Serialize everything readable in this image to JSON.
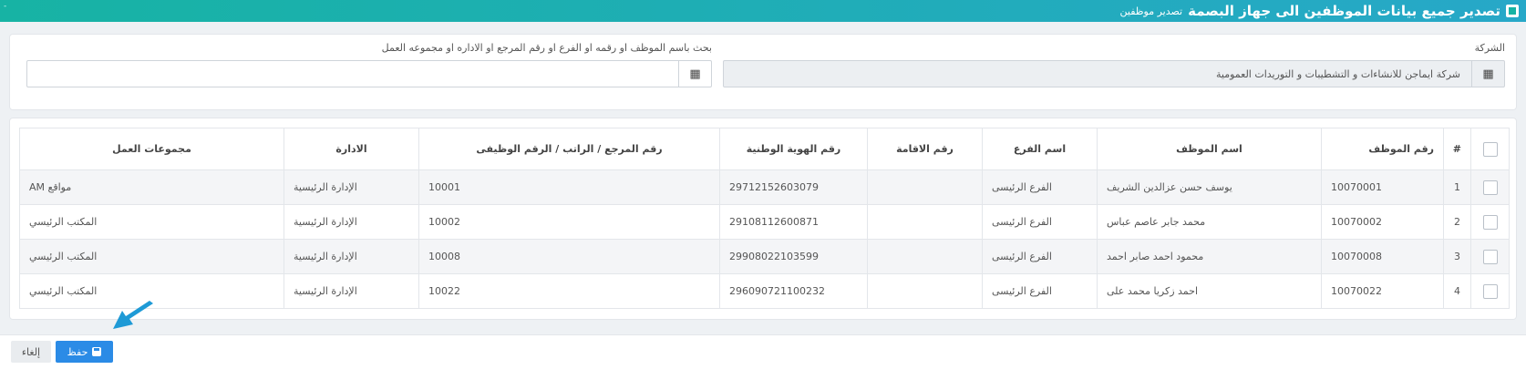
{
  "header": {
    "title": "تصدير جميع بيانات الموظفين الى جهاز البصمة",
    "subtitle": "تصدير موظفين",
    "corner_mark": "-"
  },
  "filters": {
    "company_label": "الشركة",
    "company_value": "شركة ايماجن للانشاءات و التشطيبات و التوريدات العمومية",
    "search_label": "بحث باسم الموظف او رقمه او الفرع او رقم المرجع او الاداره او مجموعه العمل",
    "search_value": "",
    "prefix_icon": "building-icon"
  },
  "table": {
    "headers": {
      "number": "#",
      "emp_id": "رقم الموظف",
      "emp_name": "اسم الموظف",
      "branch": "اسم الفرع",
      "residence": "رقم الاقامة",
      "national_id": "رقم الهوية الوطنية",
      "reference": "رقم المرجع / الراتب / الرقم الوظيفى",
      "department": "الادارة",
      "workgroup": "مجموعات العمل"
    },
    "rows": [
      {
        "num": "1",
        "emp_id": "10070001",
        "emp_name": "يوسف حسن عزالدين الشريف",
        "branch": "الفرع الرئيسى",
        "residence": "",
        "national_id": "29712152603079",
        "reference": "10001",
        "department": "الإدارة الرئيسية",
        "workgroup": "مواقع AM"
      },
      {
        "num": "2",
        "emp_id": "10070002",
        "emp_name": "محمد جابر عاصم عباس",
        "branch": "الفرع الرئيسى",
        "residence": "",
        "national_id": "29108112600871",
        "reference": "10002",
        "department": "الإدارة الرئيسية",
        "workgroup": "المكتب الرئيسي"
      },
      {
        "num": "3",
        "emp_id": "10070008",
        "emp_name": "محمود احمد صابر احمد",
        "branch": "الفرع الرئيسى",
        "residence": "",
        "national_id": "29908022103599",
        "reference": "10008",
        "department": "الإدارة الرئيسية",
        "workgroup": "المكتب الرئيسي"
      },
      {
        "num": "4",
        "emp_id": "10070022",
        "emp_name": "احمد زكريا محمد على",
        "branch": "الفرع الرئيسى",
        "residence": "",
        "national_id": "296090721100232",
        "reference": "10022",
        "department": "الإدارة الرئيسية",
        "workgroup": "المكتب الرئيسي"
      }
    ]
  },
  "footer": {
    "save_label": "حفظ",
    "cancel_label": "إلغاء"
  },
  "colors": {
    "header_gradient_start": "#17b3a4",
    "header_gradient_end": "#27a8c8",
    "primary": "#2b8be6",
    "arrow": "#1e9ad6"
  }
}
